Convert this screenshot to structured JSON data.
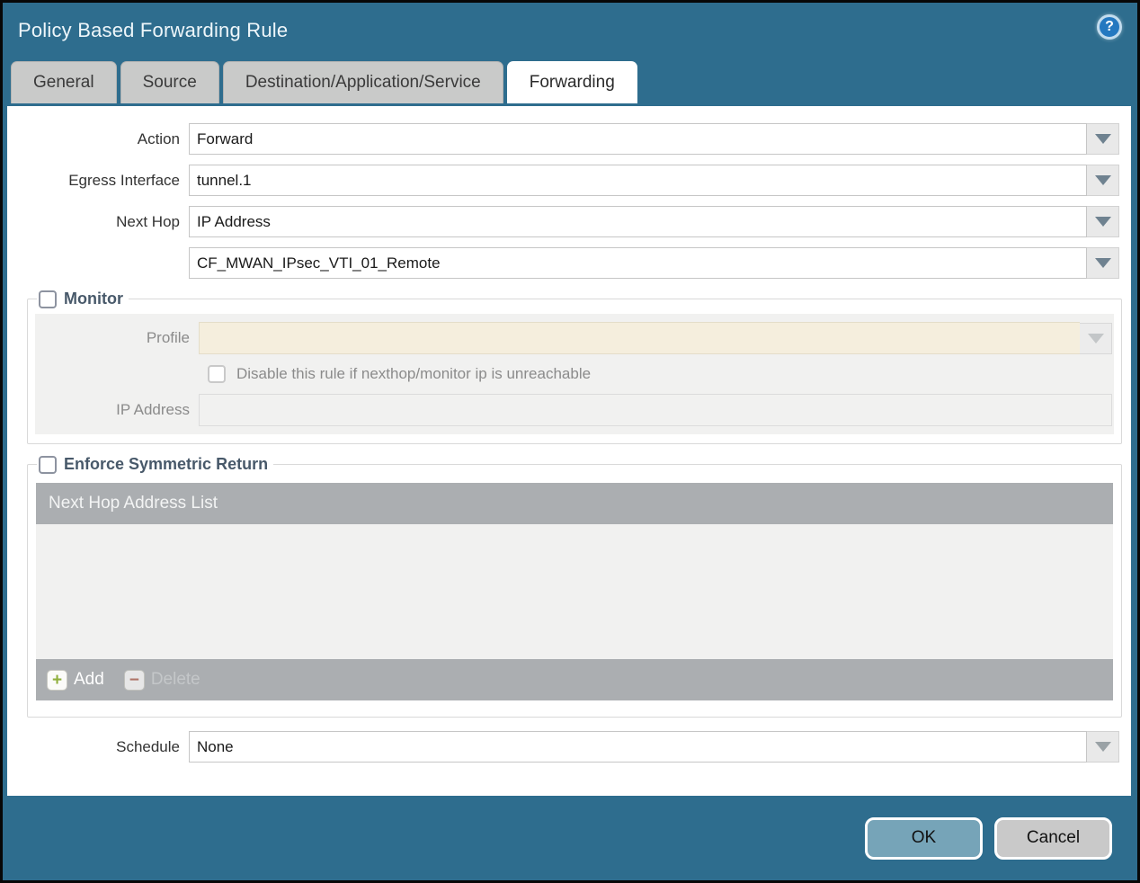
{
  "window": {
    "title": "Policy Based Forwarding Rule"
  },
  "help_icon": {
    "glyph": "?"
  },
  "tabs": [
    {
      "label": "General",
      "active": false
    },
    {
      "label": "Source",
      "active": false
    },
    {
      "label": "Destination/Application/Service",
      "active": false
    },
    {
      "label": "Forwarding",
      "active": true
    }
  ],
  "form": {
    "action": {
      "label": "Action",
      "value": "Forward"
    },
    "egress_interface": {
      "label": "Egress Interface",
      "value": "tunnel.1"
    },
    "next_hop": {
      "label": "Next Hop",
      "value": "IP Address"
    },
    "next_hop_address": {
      "value": "CF_MWAN_IPsec_VTI_01_Remote"
    },
    "schedule": {
      "label": "Schedule",
      "value": "None"
    }
  },
  "monitor": {
    "title": "Monitor",
    "checked": false,
    "profile_label": "Profile",
    "profile_value": "",
    "disable_rule_label": "Disable this rule if nexthop/monitor ip is unreachable",
    "disable_rule_checked": false,
    "ip_address_label": "IP Address",
    "ip_address_value": ""
  },
  "symmetric_return": {
    "title": "Enforce Symmetric Return",
    "checked": false,
    "table_header": "Next Hop Address List",
    "rows": [],
    "add_label": "Add",
    "delete_label": "Delete",
    "delete_enabled": false
  },
  "buttons": {
    "ok": "OK",
    "cancel": "Cancel"
  },
  "colors": {
    "frame_teal": "#2e6d8e",
    "ok_button": "#76a4b8",
    "table_gray": "#abaeb1",
    "panel_gray": "#f1f1f0",
    "disabled_beige": "#f5eedd",
    "section_title": "#48596a",
    "help_blue": "#2478c0"
  }
}
